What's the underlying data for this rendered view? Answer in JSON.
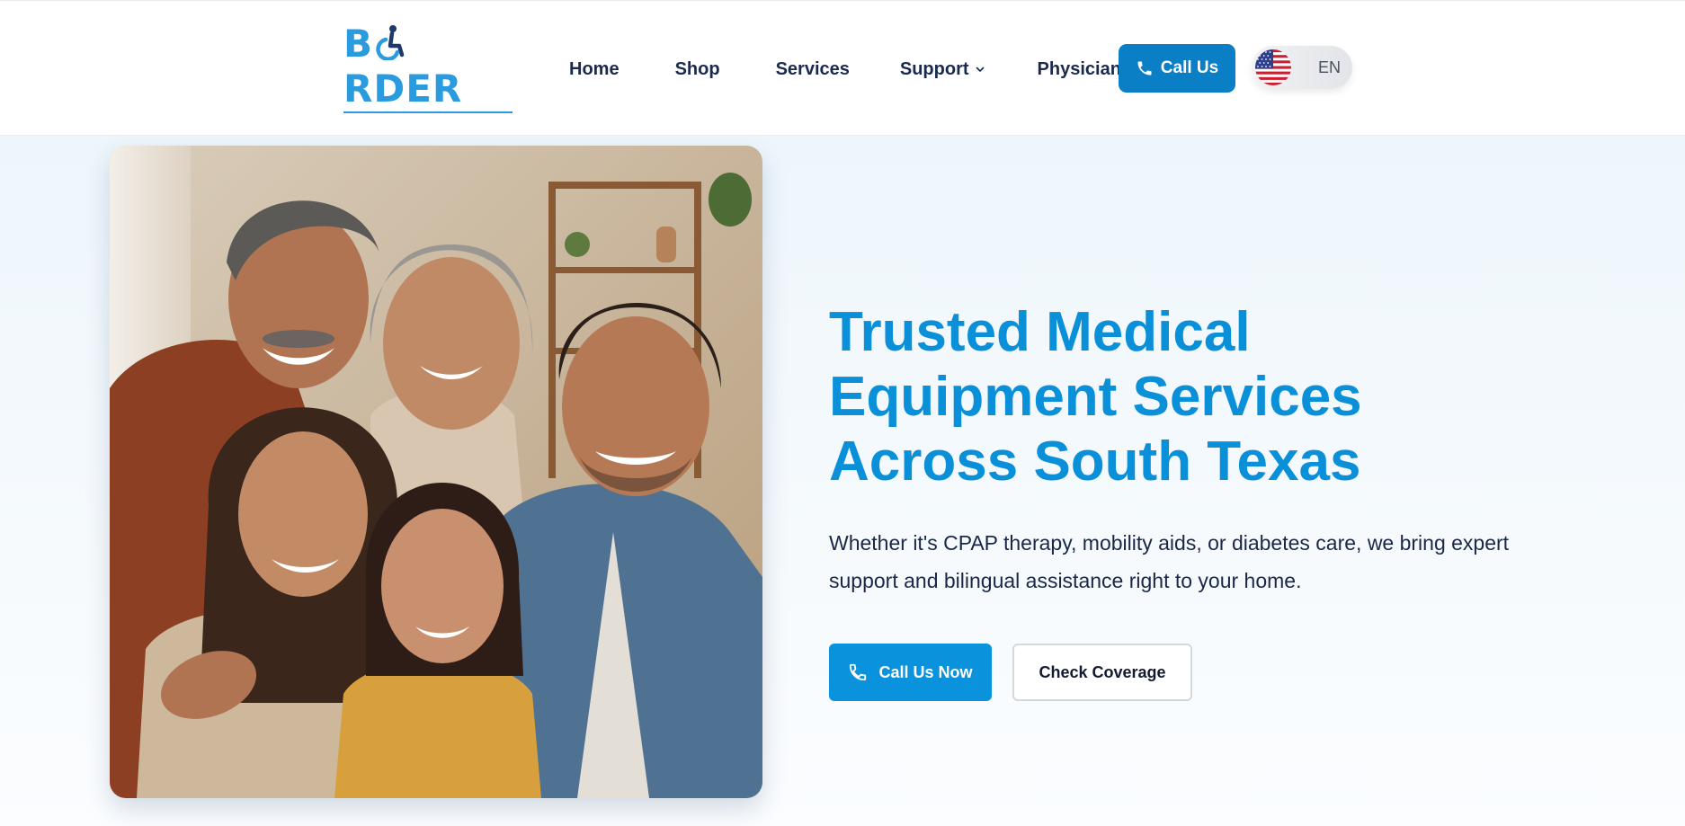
{
  "brand": {
    "logo_prefix": "B",
    "logo_suffix": "RDER",
    "logo_alt": "BORDER",
    "primary_color": "#0a8fd9",
    "dark_text_color": "#1a2a4f"
  },
  "nav": {
    "items": [
      {
        "label": "Home"
      },
      {
        "label": "Shop"
      },
      {
        "label": "Services"
      },
      {
        "label": "Support",
        "has_dropdown": true
      },
      {
        "label": "Physicians"
      }
    ],
    "call_label": "Call Us",
    "language": {
      "flag_icon": "us-flag-icon",
      "label": "EN"
    }
  },
  "hero": {
    "image": "family-portrait-photo",
    "headline": [
      "Trusted Medical",
      "Equipment Services",
      "Across South Texas"
    ],
    "subtext": "Whether it's CPAP therapy, mobility aids, or diabetes care, we bring expert support and bilingual assistance right to your home.",
    "primary_cta": "Call Us Now",
    "secondary_cta": "Check Coverage"
  }
}
